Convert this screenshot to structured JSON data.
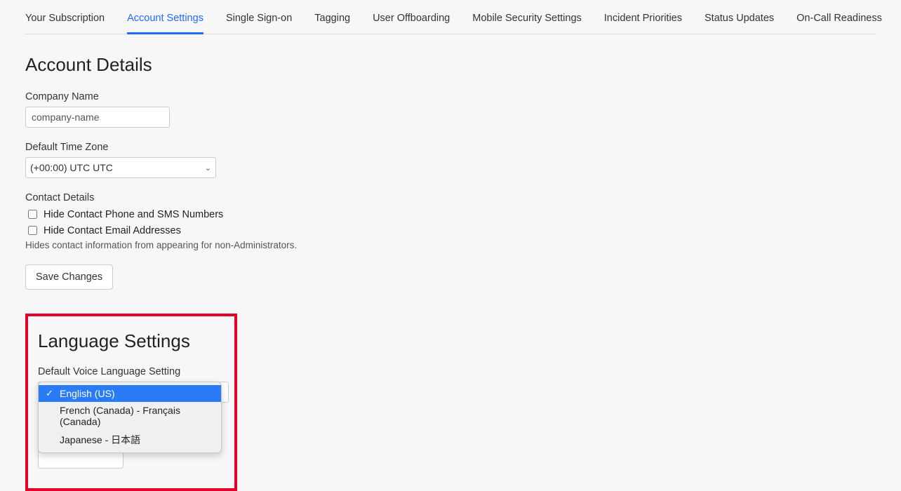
{
  "tabs": [
    {
      "label": "Your Subscription",
      "active": false
    },
    {
      "label": "Account Settings",
      "active": true
    },
    {
      "label": "Single Sign-on",
      "active": false
    },
    {
      "label": "Tagging",
      "active": false
    },
    {
      "label": "User Offboarding",
      "active": false
    },
    {
      "label": "Mobile Security Settings",
      "active": false
    },
    {
      "label": "Incident Priorities",
      "active": false
    },
    {
      "label": "Status Updates",
      "active": false
    },
    {
      "label": "On-Call Readiness",
      "active": false
    }
  ],
  "account_details": {
    "title": "Account Details",
    "company_name_label": "Company Name",
    "company_name_value": "company-name",
    "timezone_label": "Default Time Zone",
    "timezone_value": "(+00:00) UTC UTC",
    "contact_details_label": "Contact Details",
    "hide_phone_label": "Hide Contact Phone and SMS Numbers",
    "hide_email_label": "Hide Contact Email Addresses",
    "help_text": "Hides contact information from appearing for non-Administrators.",
    "save_button": "Save Changes"
  },
  "language_settings": {
    "title": "Language Settings",
    "voice_label": "Default Voice Language Setting",
    "options": [
      {
        "label": "English (US)",
        "selected": true
      },
      {
        "label": "French (Canada) - Français (Canada)",
        "selected": false
      },
      {
        "label": "Japanese - 日本語",
        "selected": false
      }
    ]
  }
}
